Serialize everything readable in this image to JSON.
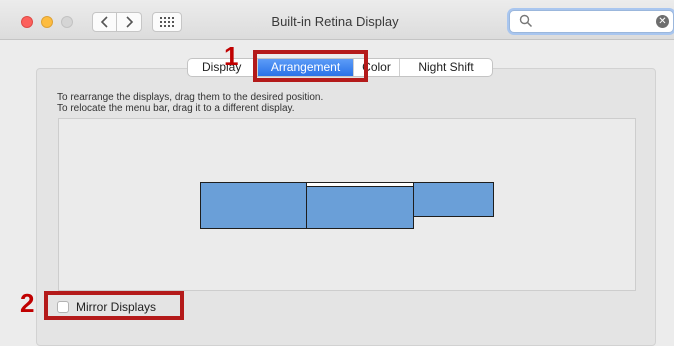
{
  "window": {
    "title": "Built-in Retina Display",
    "nav_back_icon": "chevron-left-icon",
    "nav_forward_icon": "chevron-right-icon",
    "show_all_icon": "grid-icon"
  },
  "search": {
    "placeholder": "",
    "value": ""
  },
  "tabs": [
    {
      "label": "Display",
      "selected": false
    },
    {
      "label": "Arrangement",
      "selected": true
    },
    {
      "label": "Color",
      "selected": false
    },
    {
      "label": "Night Shift",
      "selected": false
    }
  ],
  "instructions": {
    "line1": "To rearrange the displays, drag them to the desired position.",
    "line2": "To relocate the menu bar, drag it to a different display."
  },
  "displays": [
    {
      "name": "display-left",
      "has_menu_bar": false
    },
    {
      "name": "display-main",
      "has_menu_bar": true
    },
    {
      "name": "display-right",
      "has_menu_bar": false
    }
  ],
  "mirror": {
    "label": "Mirror Displays",
    "checked": false
  },
  "annotations": {
    "step1": "1",
    "step2": "2",
    "highlight_color": "#b41a1a"
  },
  "colors": {
    "accent_tab": "#2a72e8",
    "display_fill": "#6a9fd8",
    "step_number": "#c00000"
  }
}
